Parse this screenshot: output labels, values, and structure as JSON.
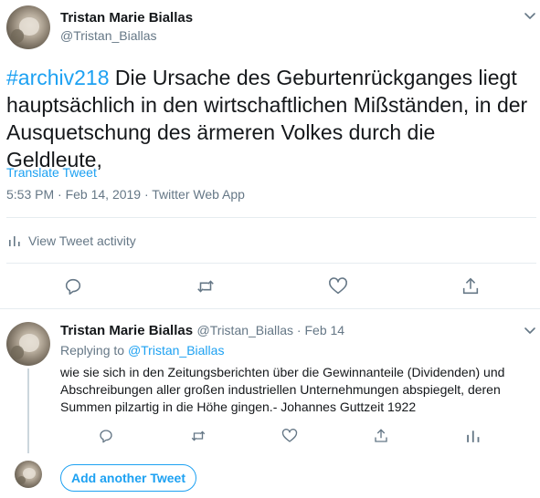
{
  "tweet": {
    "author_name": "Tristan Marie Biallas",
    "author_handle": "@Tristan_Biallas",
    "hashtag": "#archiv218",
    "text": " Die Ursache des Geburtenrückganges liegt hauptsächlich in den wirtschaftlichen Mißständen, in der Ausquetschung des ärmeren Volkes durch die Geldleute,",
    "translate_label": "Translate Tweet",
    "timestamp": "5:53 PM · Feb 14, 2019 · Twitter Web App",
    "activity_label": "View Tweet activity"
  },
  "reply": {
    "author_name": "Tristan Marie Biallas",
    "author_handle": "@Tristan_Biallas",
    "date": " · Feb 14",
    "replying_prefix": "Replying to ",
    "replying_handle": "@Tristan_Biallas",
    "text": "wie sie sich in den Zeitungsberichten über die Gewinnanteile (Dividenden) und Abschreibungen aller großen industriellen Unternehmungen abspiegelt, deren Summen pilzartig in die Höhe gingen.- Johannes Guttzeit 1922"
  },
  "compose": {
    "add_label": "Add another Tweet"
  },
  "icons": [
    "chevron-down-icon",
    "reply-icon",
    "retweet-icon",
    "like-icon",
    "share-icon",
    "analytics-icon"
  ],
  "colors": {
    "accent": "#1da1f2",
    "secondary_text": "#657786",
    "divider": "#e6ecf0"
  }
}
